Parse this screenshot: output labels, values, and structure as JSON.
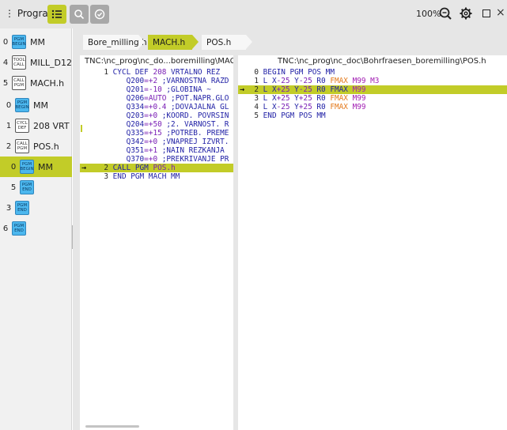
{
  "toolbar": {
    "program_label": "Program",
    "zoom": "100%",
    "icons": [
      "list-icon",
      "search-icon",
      "check-circle-icon",
      "zoom-icon",
      "settings-icon",
      "maximize-icon",
      "close-icon"
    ]
  },
  "structure": {
    "items": [
      {
        "level": "0",
        "block": [
          "PGM",
          "BEGIN"
        ],
        "style": "blue",
        "label": "MM"
      },
      {
        "level": "4",
        "block": [
          "TOOL",
          "CALL"
        ],
        "style": "outline",
        "label": "MILL_D12"
      },
      {
        "level": "5",
        "block": [
          "CALL",
          "PGM"
        ],
        "style": "outline",
        "label": "MACH.h"
      },
      {
        "level": "0",
        "block": [
          "PGM",
          "BEGIN"
        ],
        "style": "blue",
        "label": "MM"
      },
      {
        "level": "1",
        "block": [
          "CYCL",
          "DEF"
        ],
        "style": "outline",
        "label": "208 VRT"
      },
      {
        "level": "2",
        "block": [
          "CALL",
          "PGM"
        ],
        "style": "outline",
        "label": "POS.h"
      },
      {
        "level": "0",
        "block": [
          "PGM",
          "BEGIN"
        ],
        "style": "blue",
        "label": "MM"
      },
      {
        "level": "5",
        "block": [
          "PGM",
          "END"
        ],
        "style": "blue",
        "label": ""
      },
      {
        "level": "3",
        "block": [
          "PGM",
          "END"
        ],
        "style": "blue",
        "label": ""
      },
      {
        "level": "6",
        "block": [
          "PGM",
          "END"
        ],
        "style": "blue",
        "label": ""
      }
    ]
  },
  "breadcrumb": {
    "items": [
      "Bore_milling.h",
      "MACH.h",
      "POS.h"
    ]
  },
  "pane_left": {
    "path": "TNC:\\nc_prog\\nc_do...boremilling\\MACH.h",
    "lines": [
      {
        "n": "1",
        "parts": [
          [
            "kw",
            "CYCL DEF "
          ],
          [
            "num",
            "208"
          ],
          [
            "kw",
            " VRTALNO REZ"
          ]
        ]
      },
      {
        "n": "",
        "parts": [
          [
            "kw",
            "   Q200"
          ],
          [
            "num",
            "=+2"
          ],
          [
            "cm",
            " ;VARNOSTNA RAZD"
          ]
        ]
      },
      {
        "n": "",
        "parts": [
          [
            "kw",
            "   Q201"
          ],
          [
            "num",
            "=-10"
          ],
          [
            "cm",
            " ;GLOBINA ~"
          ]
        ]
      },
      {
        "n": "",
        "parts": [
          [
            "kw",
            "   Q206"
          ],
          [
            "num",
            "=AUTO"
          ],
          [
            "cm",
            " ;POT.NAPR.GLO"
          ]
        ]
      },
      {
        "n": "",
        "parts": [
          [
            "kw",
            "   Q334"
          ],
          [
            "num",
            "=+0.4"
          ],
          [
            "cm",
            " ;DOVAJALNA GL"
          ]
        ]
      },
      {
        "n": "",
        "parts": [
          [
            "kw",
            "   Q203"
          ],
          [
            "num",
            "=+0"
          ],
          [
            "cm",
            " ;KOORD. POVRSIN"
          ]
        ]
      },
      {
        "n": "",
        "parts": [
          [
            "kw",
            "   Q204"
          ],
          [
            "num",
            "=+50"
          ],
          [
            "cm",
            " ;2. VARNOST. R"
          ]
        ]
      },
      {
        "n": "",
        "parts": [
          [
            "kw",
            "   Q335"
          ],
          [
            "num",
            "=+15"
          ],
          [
            "cm",
            " ;POTREB. PREME"
          ]
        ]
      },
      {
        "n": "",
        "parts": [
          [
            "kw",
            "   Q342"
          ],
          [
            "num",
            "=+0"
          ],
          [
            "cm",
            " ;VNAPREJ IZVRT."
          ]
        ]
      },
      {
        "n": "",
        "parts": [
          [
            "kw",
            "   Q351"
          ],
          [
            "num",
            "=+1"
          ],
          [
            "cm",
            " ;NAIN REZKANJA"
          ]
        ]
      },
      {
        "n": "",
        "parts": [
          [
            "kw",
            "   Q370"
          ],
          [
            "num",
            "=+0"
          ],
          [
            "cm",
            " ;PREKRIVANJE PR"
          ]
        ]
      },
      {
        "n": "2",
        "parts": [
          [
            "kw",
            "CALL PGM "
          ],
          [
            "num",
            "POS.h"
          ]
        ],
        "active": true
      },
      {
        "n": "3",
        "parts": [
          [
            "kw",
            "END PGM MACH MM"
          ]
        ]
      }
    ]
  },
  "pane_right": {
    "path": "TNC:\\nc_prog\\nc_doc\\Bohrfraesen_boremilling\\POS.h",
    "lines": [
      {
        "n": "0",
        "parts": [
          [
            "kw",
            "BEGIN PGM POS MM"
          ]
        ]
      },
      {
        "n": "1",
        "parts": [
          [
            "kw",
            "L X"
          ],
          [
            "num",
            "-25"
          ],
          [
            "kw",
            " Y"
          ],
          [
            "num",
            "-25"
          ],
          [
            "kw",
            " R0 "
          ],
          [
            "or",
            "FMAX"
          ],
          [
            "pu",
            " M99 M3"
          ]
        ]
      },
      {
        "n": "2",
        "parts": [
          [
            "kw",
            "L X"
          ],
          [
            "num",
            "+25"
          ],
          [
            "kw",
            " Y"
          ],
          [
            "num",
            "-25"
          ],
          [
            "kw",
            " R0 "
          ],
          [
            "kw",
            "FMAX"
          ],
          [
            "pu",
            " M99"
          ]
        ],
        "active": true
      },
      {
        "n": "3",
        "parts": [
          [
            "kw",
            "L X"
          ],
          [
            "num",
            "+25"
          ],
          [
            "kw",
            " Y"
          ],
          [
            "num",
            "+25"
          ],
          [
            "kw",
            " R0 "
          ],
          [
            "or",
            "FMAX"
          ],
          [
            "pu",
            " M99"
          ]
        ]
      },
      {
        "n": "4",
        "parts": [
          [
            "kw",
            "L X"
          ],
          [
            "num",
            "-25"
          ],
          [
            "kw",
            " Y"
          ],
          [
            "num",
            "+25"
          ],
          [
            "kw",
            " R0 "
          ],
          [
            "or",
            "FMAX"
          ],
          [
            "pu",
            " M99"
          ]
        ]
      },
      {
        "n": "5",
        "parts": [
          [
            "kw",
            "END PGM POS MM"
          ]
        ]
      }
    ]
  },
  "colors": {
    "accent": "#c2cc28",
    "keyword": "#1f1fa5",
    "number": "#7a1fb5",
    "feed": "#e47a1c",
    "mfunc": "#a21fb3",
    "block_blue": "#4cb7ee"
  }
}
